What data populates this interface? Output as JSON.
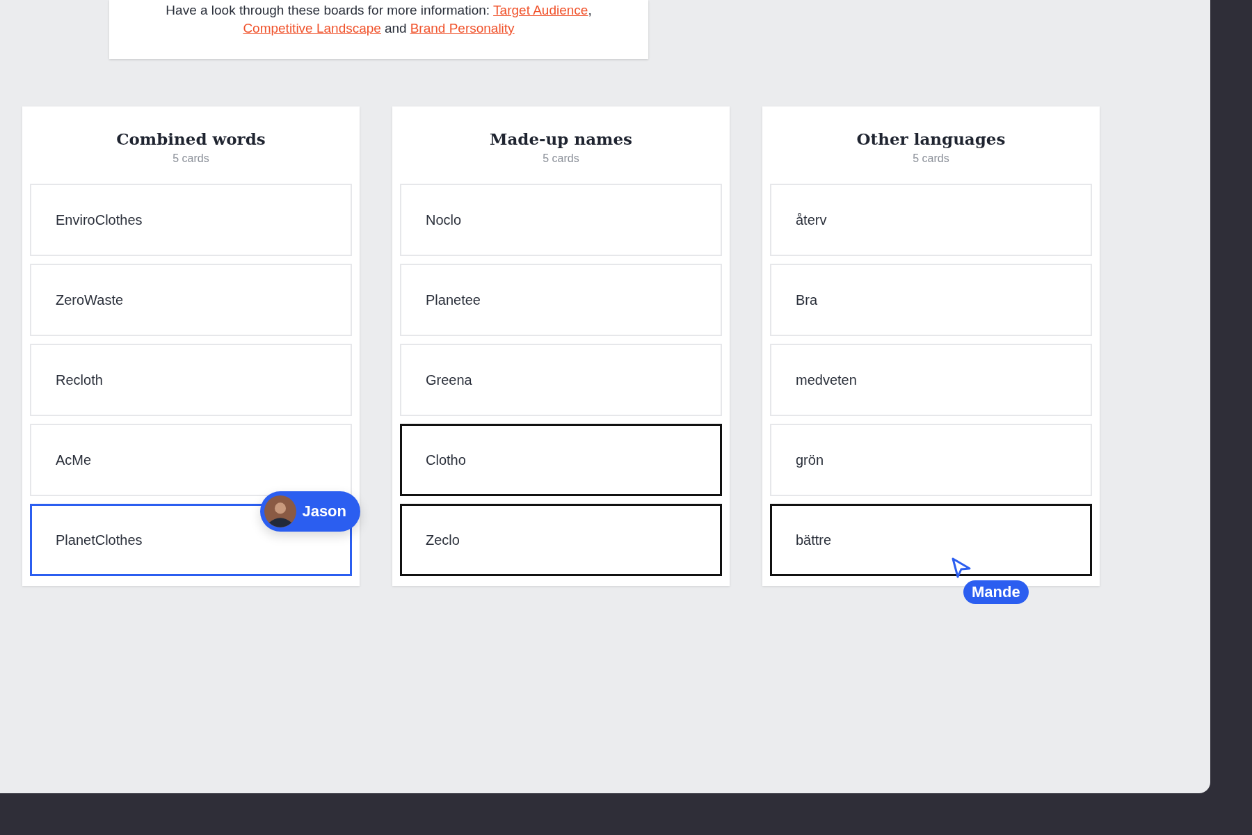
{
  "intro": {
    "text": "Have a look through these boards for more information:",
    "links": [
      "Target Audience",
      "Competitive Landscape",
      "Brand Personality"
    ],
    "separator": ",",
    "conjunction": "and"
  },
  "columns": [
    {
      "title": "Combined words",
      "count": "5 cards",
      "cards": [
        {
          "label": "EnviroClothes",
          "outlined": false
        },
        {
          "label": "ZeroWaste",
          "outlined": false
        },
        {
          "label": "Recloth",
          "outlined": false
        },
        {
          "label": "AcMe",
          "outlined": false
        },
        {
          "label": "PlanetClothes",
          "collaborator": "Jason"
        }
      ]
    },
    {
      "title": "Made-up names",
      "count": "5 cards",
      "cards": [
        {
          "label": "Noclo",
          "outlined": false
        },
        {
          "label": "Planetee",
          "outlined": false
        },
        {
          "label": "Greena",
          "outlined": false
        },
        {
          "label": "Clotho",
          "outlined": true
        },
        {
          "label": "Zeclo",
          "outlined": true
        }
      ]
    },
    {
      "title": "Other languages",
      "count": "5 cards",
      "cards": [
        {
          "label": "återv",
          "outlined": false
        },
        {
          "label": "Bra",
          "outlined": false
        },
        {
          "label": "medveten",
          "outlined": false
        },
        {
          "label": "grön",
          "outlined": false
        },
        {
          "label": "bättre",
          "outlined": true,
          "cursor": "Mande"
        }
      ]
    }
  ]
}
